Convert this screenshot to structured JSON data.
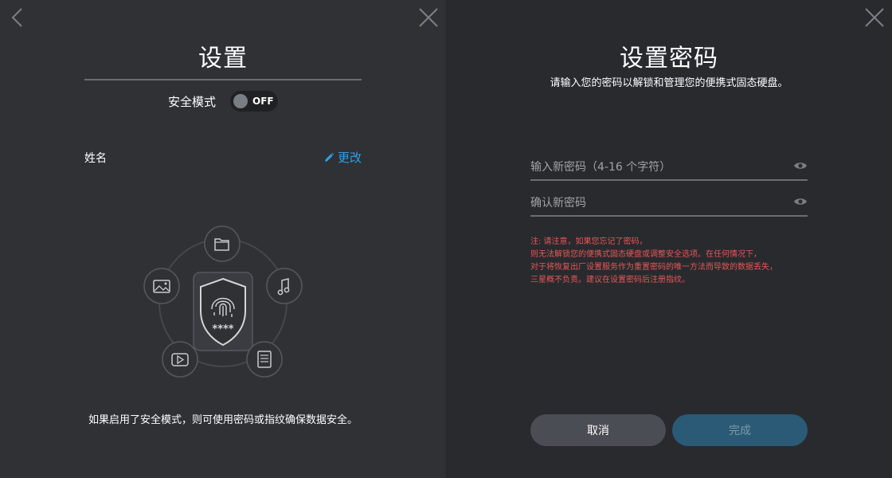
{
  "settings": {
    "title": "设置",
    "safe_mode_label": "安全模式",
    "toggle_state": "OFF",
    "name_label": "姓名",
    "edit_label": "更改",
    "note": "如果启用了安全模式，则可使用密码或指纹确保数据安全。",
    "pin_dots": "****"
  },
  "password": {
    "title": "设置密码",
    "subtitle": "请输入您的密码以解锁和管理您的便携式固态硬盘。",
    "new_placeholder": "输入新密码（4-16 个字符）",
    "confirm_placeholder": "确认新密码",
    "warning_lines": [
      "注: 请注意，如果您忘记了密码，",
      "则无法解锁您的便携式固态硬盘或调整安全选项。在任何情况下，",
      "对于将恢复出厂设置服务作为重置密码的唯一方法而导致的数据丢失，",
      "三星概不负责。建议在设置密码后注册指纹。"
    ],
    "cancel_label": "取消",
    "done_label": "完成"
  },
  "icons": {
    "back": "chevron-left-icon",
    "close": "close-icon",
    "edit": "pencil-icon",
    "folder": "folder-icon",
    "music": "music-icon",
    "document": "document-icon",
    "video": "video-play-icon",
    "image": "image-icon",
    "shield": "fingerprint-shield-icon",
    "eye": "eye-icon"
  },
  "colors": {
    "accent": "#2d9fe6",
    "warning": "#e85656",
    "done_button": "#2b5a76",
    "cancel_button": "#4a4d53"
  }
}
